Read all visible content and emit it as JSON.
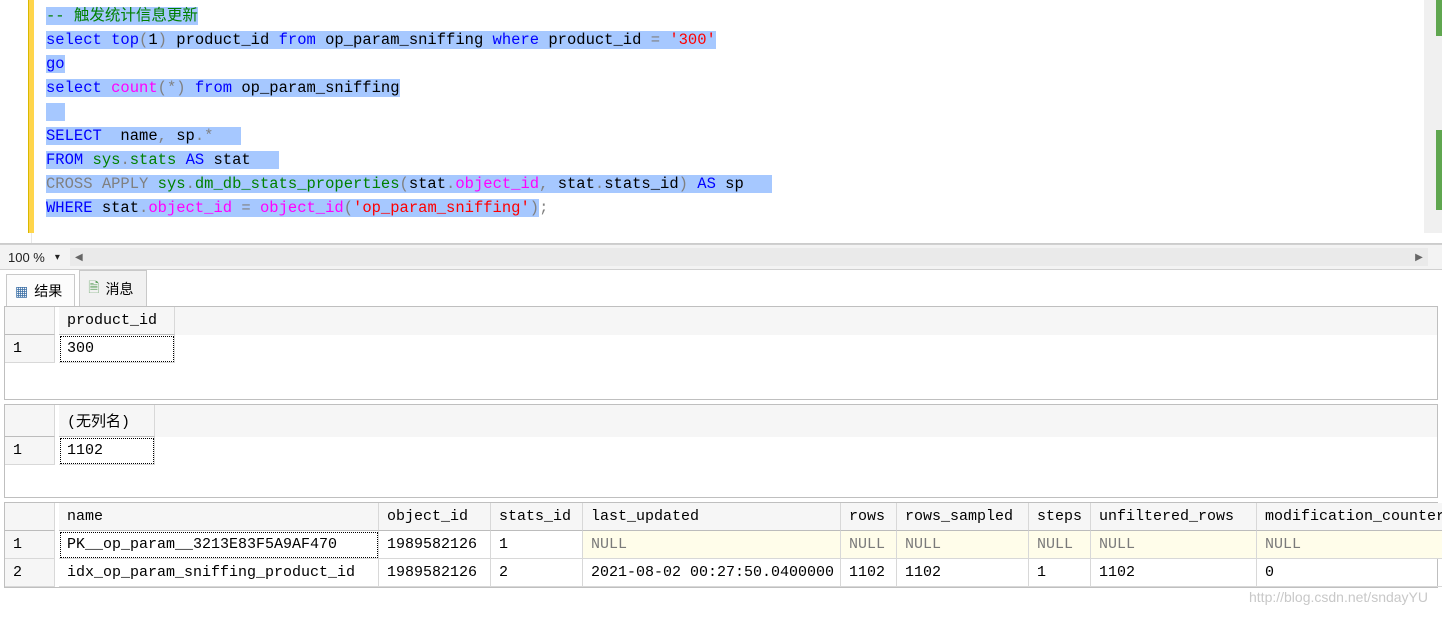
{
  "editor": {
    "zoom": "100 %",
    "code_tokens": [
      [
        {
          "t": "-- 触发统计信息更新",
          "cls": "comment sel"
        }
      ],
      [
        {
          "t": "select",
          "cls": "kw-blue sel"
        },
        {
          "t": " ",
          "cls": "sel"
        },
        {
          "t": "top",
          "cls": "kw-blue sel"
        },
        {
          "t": "(",
          "cls": "kw-grey sel"
        },
        {
          "t": "1",
          "cls": "sel"
        },
        {
          "t": ")",
          "cls": "kw-grey sel"
        },
        {
          "t": " product_id ",
          "cls": "sel"
        },
        {
          "t": "from",
          "cls": "kw-blue sel"
        },
        {
          "t": " op_param_sniffing ",
          "cls": "sel"
        },
        {
          "t": "where",
          "cls": "kw-blue sel"
        },
        {
          "t": " product_id ",
          "cls": "sel"
        },
        {
          "t": "=",
          "cls": "kw-grey sel"
        },
        {
          "t": " ",
          "cls": "sel"
        },
        {
          "t": "'300'",
          "cls": "str sel"
        }
      ],
      [
        {
          "t": "go",
          "cls": "kw-blue sel"
        }
      ],
      [
        {
          "t": "select",
          "cls": "kw-blue sel"
        },
        {
          "t": " ",
          "cls": "sel"
        },
        {
          "t": "count",
          "cls": "magenta sel"
        },
        {
          "t": "(*)",
          "cls": "kw-grey sel"
        },
        {
          "t": " ",
          "cls": "sel"
        },
        {
          "t": "from",
          "cls": "kw-blue sel"
        },
        {
          "t": " op_param_sniffing",
          "cls": "sel"
        }
      ],
      [
        {
          "t": "  ",
          "cls": "sel"
        }
      ],
      [
        {
          "t": "SELECT",
          "cls": "kw-blue sel"
        },
        {
          "t": "  name",
          "cls": "sel"
        },
        {
          "t": ",",
          "cls": "kw-grey sel"
        },
        {
          "t": " sp",
          "cls": "sel"
        },
        {
          "t": ".*",
          "cls": "kw-grey sel"
        },
        {
          "t": "   ",
          "cls": "sel"
        }
      ],
      [
        {
          "t": "FROM",
          "cls": "kw-blue sel"
        },
        {
          "t": " ",
          "cls": "sel"
        },
        {
          "t": "sys",
          "cls": "sysgreen sel"
        },
        {
          "t": ".",
          "cls": "kw-grey sel"
        },
        {
          "t": "stats",
          "cls": "sysgreen sel"
        },
        {
          "t": " ",
          "cls": "sel"
        },
        {
          "t": "AS",
          "cls": "kw-blue sel"
        },
        {
          "t": " stat   ",
          "cls": "sel"
        }
      ],
      [
        {
          "t": "CROSS",
          "cls": "kw-grey sel"
        },
        {
          "t": " ",
          "cls": "sel"
        },
        {
          "t": "APPLY",
          "cls": "kw-grey sel"
        },
        {
          "t": " ",
          "cls": "sel"
        },
        {
          "t": "sys",
          "cls": "sysgreen sel"
        },
        {
          "t": ".",
          "cls": "kw-grey sel"
        },
        {
          "t": "dm_db_stats_properties",
          "cls": "sysgreen sel"
        },
        {
          "t": "(",
          "cls": "kw-grey sel"
        },
        {
          "t": "stat",
          "cls": "sel"
        },
        {
          "t": ".",
          "cls": "kw-grey sel"
        },
        {
          "t": "object_id",
          "cls": "magenta sel"
        },
        {
          "t": ",",
          "cls": "kw-grey sel"
        },
        {
          "t": " stat",
          "cls": "sel"
        },
        {
          "t": ".",
          "cls": "kw-grey sel"
        },
        {
          "t": "stats_id",
          "cls": "sel"
        },
        {
          "t": ")",
          "cls": "kw-grey sel"
        },
        {
          "t": " ",
          "cls": "sel"
        },
        {
          "t": "AS",
          "cls": "kw-blue sel"
        },
        {
          "t": " sp   ",
          "cls": "sel"
        }
      ],
      [
        {
          "t": "WHERE",
          "cls": "kw-blue sel"
        },
        {
          "t": " stat",
          "cls": "sel"
        },
        {
          "t": ".",
          "cls": "kw-grey sel"
        },
        {
          "t": "object_id",
          "cls": "magenta sel"
        },
        {
          "t": " ",
          "cls": "sel"
        },
        {
          "t": "=",
          "cls": "kw-grey sel"
        },
        {
          "t": " ",
          "cls": "sel"
        },
        {
          "t": "object_id",
          "cls": "magenta sel"
        },
        {
          "t": "(",
          "cls": "kw-grey sel"
        },
        {
          "t": "'op_param_sniffing'",
          "cls": "str sel"
        },
        {
          "t": ")",
          "cls": "kw-grey sel"
        },
        {
          "t": ";",
          "cls": "kw-grey"
        }
      ]
    ]
  },
  "tabs": {
    "results": "结果",
    "messages": "消息"
  },
  "grid1": {
    "headers": [
      "product_id"
    ],
    "rows": [
      [
        "300"
      ]
    ]
  },
  "grid2": {
    "headers": [
      "(无列名)"
    ],
    "rows": [
      [
        "1102"
      ]
    ]
  },
  "grid3": {
    "headers": [
      "name",
      "object_id",
      "stats_id",
      "last_updated",
      "rows",
      "rows_sampled",
      "steps",
      "unfiltered_rows",
      "modification_counter"
    ],
    "rows": [
      {
        "null_row": true,
        "cells": [
          "PK__op_param__3213E83F5A9AF470",
          "1989582126",
          "1",
          "NULL",
          "NULL",
          "NULL",
          "NULL",
          "NULL",
          "NULL"
        ]
      },
      {
        "null_row": false,
        "cells": [
          "idx_op_param_sniffing_product_id",
          "1989582126",
          "2",
          "2021-08-02 00:27:50.0400000",
          "1102",
          "1102",
          "1",
          "1102",
          "0"
        ]
      }
    ]
  },
  "watermark": "http://blog.csdn.net/sndayYU"
}
